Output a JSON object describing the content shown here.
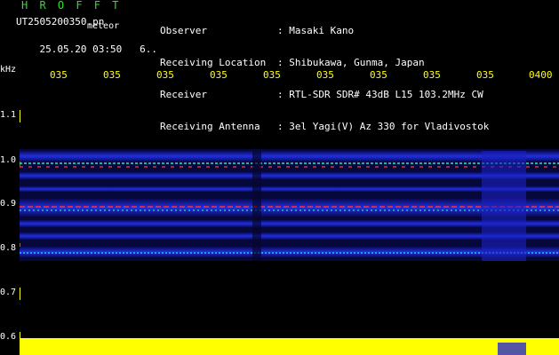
{
  "header": {
    "brand": "H R O F F T",
    "filename": "UT2505200350.pn",
    "meteor_label": "meteor",
    "datetime": "25.05.20 03:50",
    "index": "6..",
    "meta": [
      {
        "label": "Observer",
        "value": ": Masaki Kano"
      },
      {
        "label": "Receiving Location",
        "value": ": Shibukawa, Gunma, Japan"
      },
      {
        "label": "Receiver",
        "value": ": RTL-SDR SDR# 43dB L15 103.2MHz CW"
      },
      {
        "label": "Receiving Antenna",
        "value": ": 3el Yagi(V) Az 330 for Vladivostok"
      }
    ]
  },
  "axes": {
    "unit": "kHz",
    "x_ticks": [
      "035",
      "035",
      "035",
      "035",
      "035",
      "035",
      "035",
      "035",
      "035",
      "0400"
    ],
    "y_ticks": [
      "1.1",
      "1.0",
      "0.9",
      "0.8",
      "0.7",
      "0.6"
    ]
  },
  "colors": {
    "background": "#000000",
    "brand": "#2be02b",
    "tick": "#ffff00",
    "band": "#1c2bd8",
    "noise": "#ffff00"
  }
}
